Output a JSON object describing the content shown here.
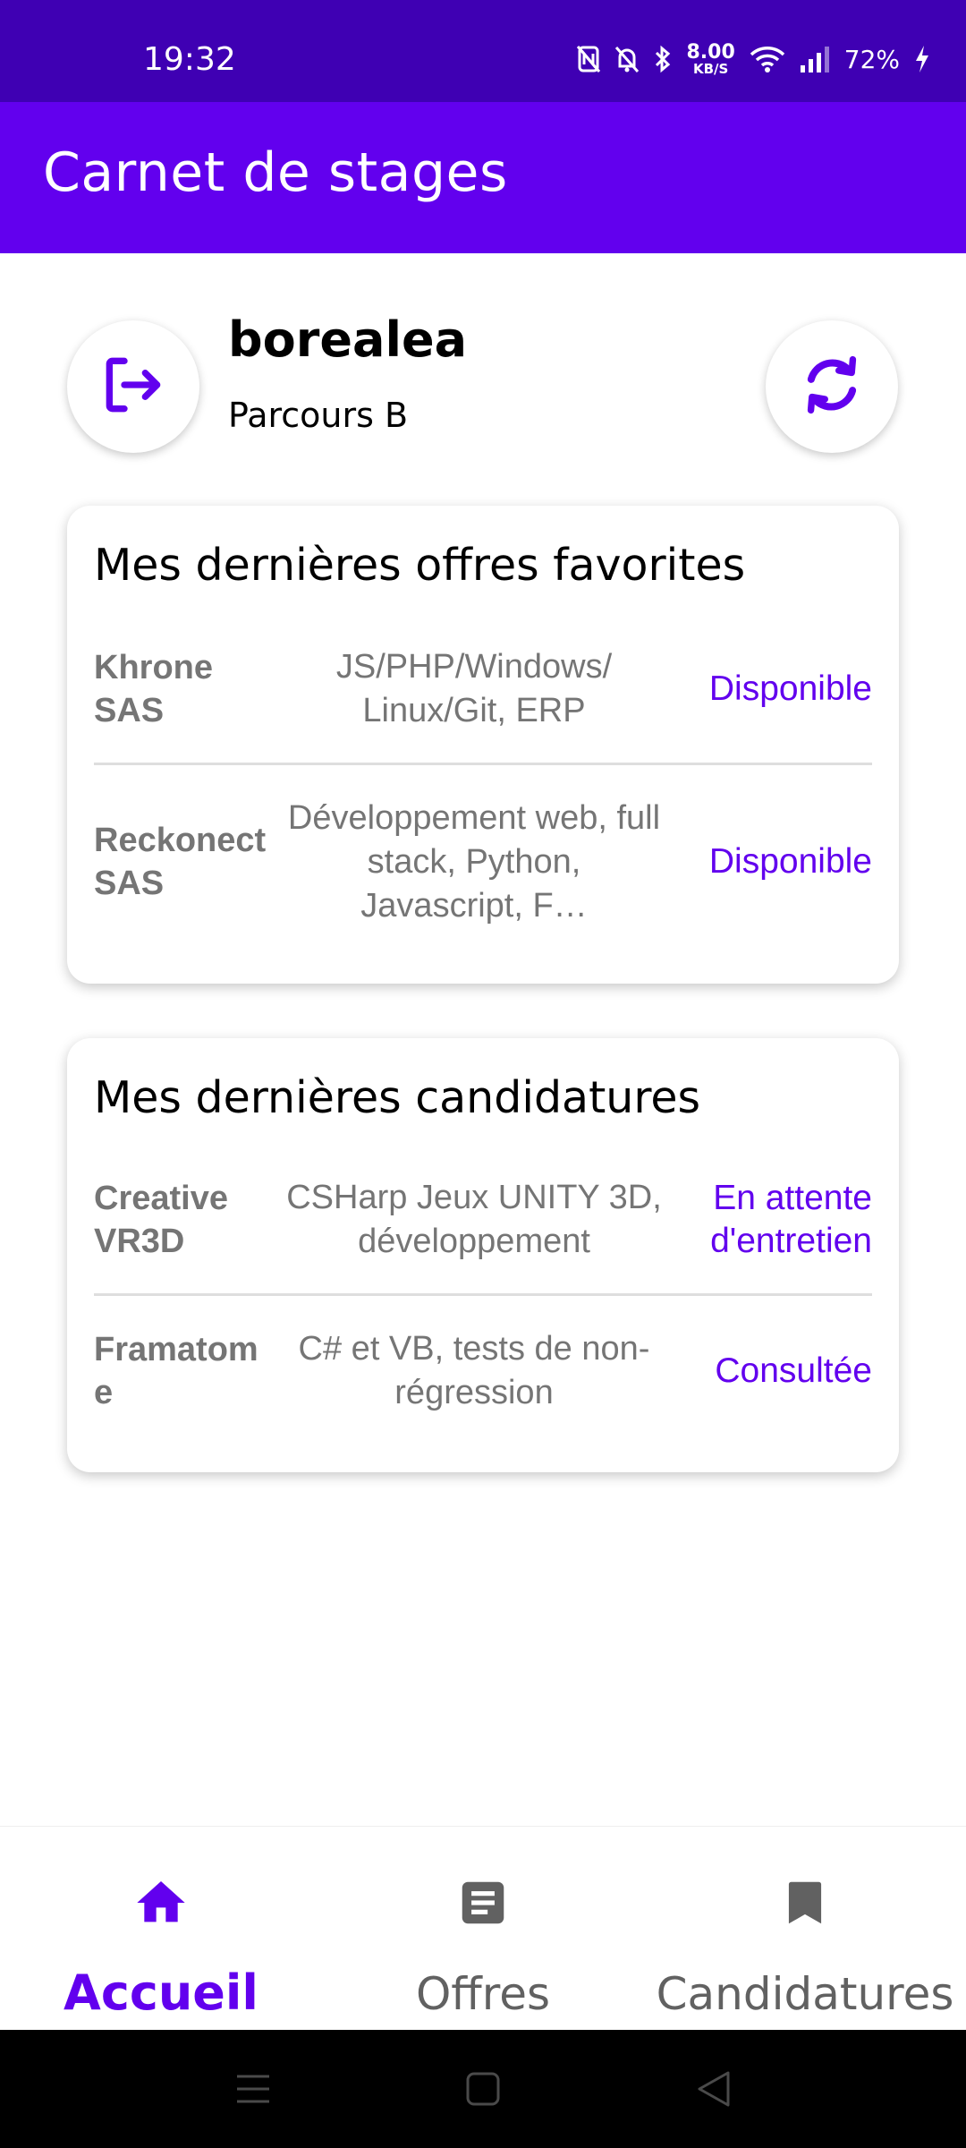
{
  "status_bar": {
    "time": "19:32",
    "network_speed_value": "8.00",
    "network_speed_unit": "KB/S",
    "battery": "72%",
    "icons": [
      "nfc-off-icon",
      "bell-off-icon",
      "bluetooth-icon",
      "wifi-icon",
      "signal-icon",
      "charging-icon"
    ]
  },
  "app_bar": {
    "title": "Carnet de stages"
  },
  "user": {
    "name": "borealea",
    "track": "Parcours B"
  },
  "favorites": {
    "title": "Mes dernières offres favorites",
    "rows": [
      {
        "company": "Khrone SAS",
        "description": "JS/PHP/Windows/ Linux/Git, ERP",
        "status": "Disponible"
      },
      {
        "company": "Reckonect SAS",
        "description": "Développement web, full stack, Python, Javascript, F…",
        "status": "Disponible"
      }
    ]
  },
  "applications": {
    "title": "Mes dernières candidatures",
    "rows": [
      {
        "company": "Creative VR3D",
        "description": "CSHarp Jeux UNITY 3D, développement",
        "status": "En attente d'entretien"
      },
      {
        "company": "Framatom e",
        "description": "C# et VB, tests de non-régression",
        "status": "Consultée"
      }
    ]
  },
  "bottom_nav": {
    "items": [
      {
        "label": "Accueil",
        "icon": "home-icon",
        "active": true
      },
      {
        "label": "Offres",
        "icon": "article-icon",
        "active": false
      },
      {
        "label": "Candidatures",
        "icon": "bookmark-icon",
        "active": false
      }
    ]
  },
  "colors": {
    "status_bar": "#3f00b3",
    "primary": "#6200ee",
    "muted_text": "#757575"
  }
}
